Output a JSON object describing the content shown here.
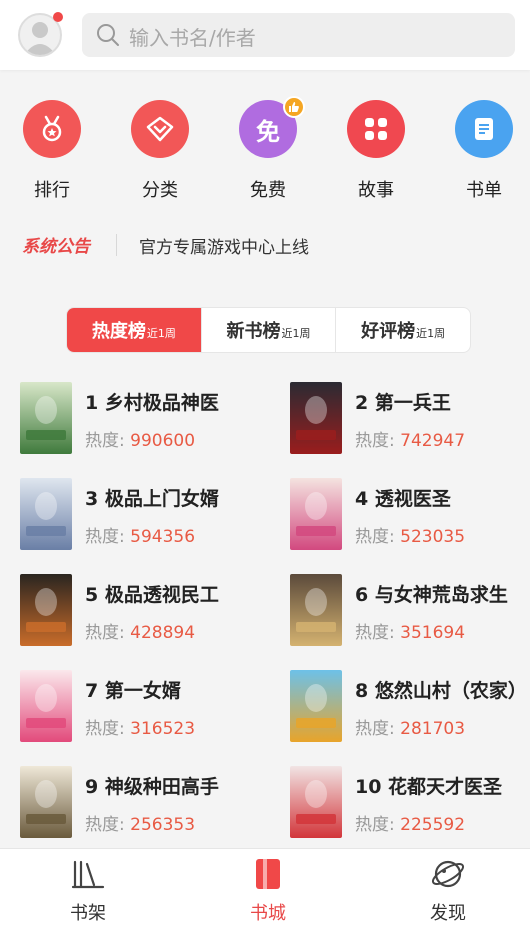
{
  "header": {
    "search_placeholder": "输入书名/作者"
  },
  "categories": [
    {
      "label": "排行",
      "color": "#f25757",
      "icon": "medal-icon"
    },
    {
      "label": "分类",
      "color": "#f25757",
      "icon": "diamond-icon"
    },
    {
      "label": "免费",
      "color": "#b06ce0",
      "icon_text": "免",
      "icon": "free-icon"
    },
    {
      "label": "故事",
      "color": "#f04850",
      "icon": "grid-icon"
    },
    {
      "label": "书单",
      "color": "#4aa3f0",
      "icon": "list-icon"
    }
  ],
  "notice": {
    "logo": "系统公告",
    "text": "官方专属游戏中心上线"
  },
  "tabs": [
    {
      "label": "热度榜",
      "sub": "近1周"
    },
    {
      "label": "新书榜",
      "sub": "近1周"
    },
    {
      "label": "好评榜",
      "sub": "近1周"
    }
  ],
  "heat_label": "热度: ",
  "books": [
    {
      "title": "1 乡村极品神医",
      "heat": "990600",
      "cover_colors": [
        "#d8e7c9",
        "#3f7a3c"
      ]
    },
    {
      "title": "2 第一兵王",
      "heat": "742947",
      "cover_colors": [
        "#2b2b33",
        "#9a1d1d"
      ]
    },
    {
      "title": "3 极品上门女婿",
      "heat": "594356",
      "cover_colors": [
        "#dfe6ef",
        "#6a7fa6"
      ]
    },
    {
      "title": "4 透视医圣",
      "heat": "523035",
      "cover_colors": [
        "#f4e3e0",
        "#d2497f"
      ]
    },
    {
      "title": "5 极品透视民工",
      "heat": "428894",
      "cover_colors": [
        "#2a2520",
        "#c96c2a"
      ]
    },
    {
      "title": "6 与女神荒岛求生",
      "heat": "351694",
      "cover_colors": [
        "#5b4a3b",
        "#d4b270"
      ]
    },
    {
      "title": "7 第一女婿",
      "heat": "316523",
      "cover_colors": [
        "#fbe8ec",
        "#e24a7b"
      ]
    },
    {
      "title": "8 悠然山村（农家）",
      "heat": "281703",
      "cover_colors": [
        "#6dc1e8",
        "#e8a42a"
      ]
    },
    {
      "title": "9 神级种田高手",
      "heat": "256353",
      "cover_colors": [
        "#efe8d8",
        "#6a5a3c"
      ]
    },
    {
      "title": "10 花都天才医圣",
      "heat": "225592",
      "cover_colors": [
        "#f1e4e4",
        "#d2353a"
      ]
    }
  ],
  "bottom_nav": [
    {
      "label": "书架",
      "icon": "bookshelf-icon"
    },
    {
      "label": "书城",
      "icon": "bookstore-icon"
    },
    {
      "label": "发现",
      "icon": "planet-icon"
    }
  ],
  "colors": {
    "accent": "#f04848",
    "heat_value": "#e85a44"
  }
}
